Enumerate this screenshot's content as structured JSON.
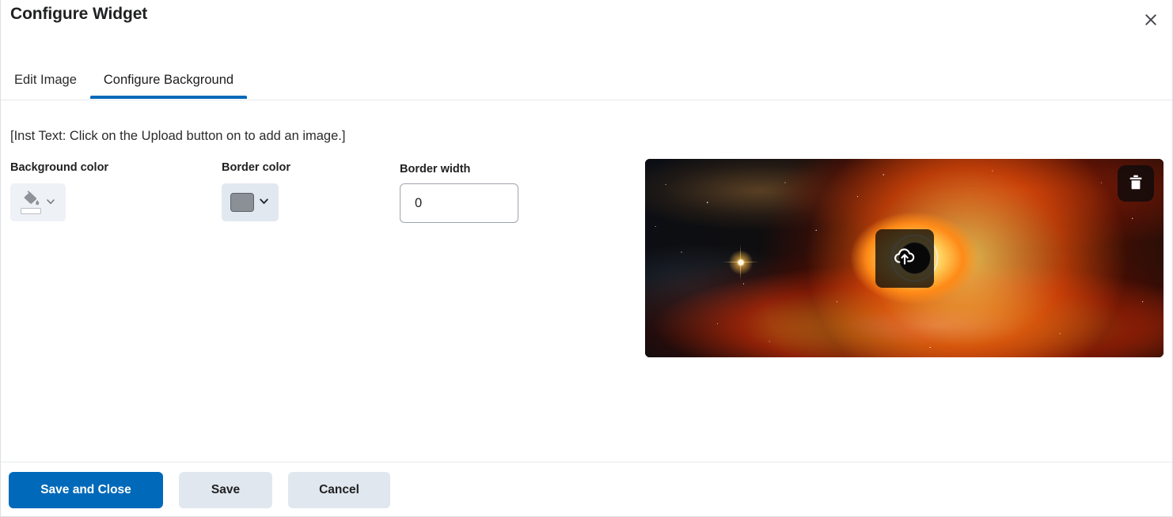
{
  "dialog": {
    "title": "Configure Widget",
    "close_icon": "close-icon"
  },
  "tabs": [
    {
      "label": "Edit Image",
      "active": false
    },
    {
      "label": "Configure Background",
      "active": true
    }
  ],
  "main": {
    "instruction_text": "[Inst Text: Click on the Upload button on to add an image.]",
    "fields": {
      "background_color": {
        "label": "Background color",
        "icon": "paint-bucket-icon",
        "swatch_color": "#ffffff",
        "chevron": "chevron-down-icon"
      },
      "border_color": {
        "label": "Border color",
        "swatch_color": "#8b9096",
        "chevron": "chevron-down-icon"
      },
      "border_width": {
        "label": "Border width",
        "value": "0",
        "placeholder": "0"
      }
    },
    "image_preview": {
      "alt": "black hole accretion disk space image",
      "upload_icon": "cloud-upload-icon",
      "delete_icon": "trash-icon"
    }
  },
  "footer": {
    "save_and_close_label": "Save and Close",
    "save_label": "Save",
    "cancel_label": "Cancel"
  },
  "colors": {
    "accent": "#0069b9",
    "secondary_button": "#e1e7ee",
    "divider": "#e3e8ec",
    "text": "#202122"
  }
}
